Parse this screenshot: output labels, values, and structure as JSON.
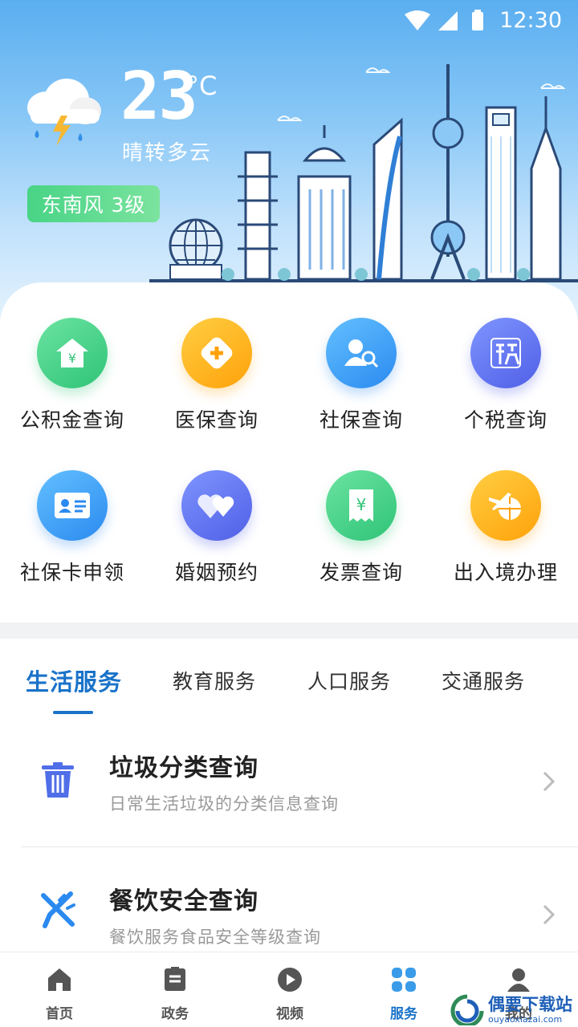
{
  "status_bar": {
    "time": "12:30"
  },
  "weather": {
    "temperature": "23",
    "unit": "°C",
    "description": "晴转多云",
    "wind": "东南风 3级",
    "icon": "thunder-rain-cloud-icon"
  },
  "services": [
    {
      "label": "公积金查询",
      "icon": "house-yuan-icon",
      "color": "#34c478"
    },
    {
      "label": "医保查询",
      "icon": "medical-cross-icon",
      "color": "#ffa20a"
    },
    {
      "label": "社保查询",
      "icon": "person-search-icon",
      "color": "#2b8af0"
    },
    {
      "label": "个税查询",
      "icon": "tax-icon",
      "color": "#4f5fe6"
    },
    {
      "label": "社保卡申领",
      "icon": "id-card-icon",
      "color": "#2b8af0"
    },
    {
      "label": "婚姻预约",
      "icon": "hearts-icon",
      "color": "#4f5fe6"
    },
    {
      "label": "发票查询",
      "icon": "invoice-yuan-icon",
      "color": "#34c478"
    },
    {
      "label": "出入境办理",
      "icon": "plane-globe-icon",
      "color": "#ffa20a"
    }
  ],
  "tabs": [
    {
      "label": "生活服务",
      "active": true
    },
    {
      "label": "教育服务",
      "active": false
    },
    {
      "label": "人口服务",
      "active": false
    },
    {
      "label": "交通服务",
      "active": false
    }
  ],
  "list": [
    {
      "title": "垃圾分类查询",
      "subtitle": "日常生活垃圾的分类信息查询",
      "icon": "trash-icon"
    },
    {
      "title": "餐饮安全查询",
      "subtitle": "餐饮服务食品安全等级查询",
      "icon": "fork-knife-icon"
    }
  ],
  "bottom_nav": [
    {
      "label": "首页",
      "icon": "home-icon",
      "active": false
    },
    {
      "label": "政务",
      "icon": "document-icon",
      "active": false
    },
    {
      "label": "视频",
      "icon": "play-icon",
      "active": false
    },
    {
      "label": "服务",
      "icon": "grid-icon",
      "active": true
    },
    {
      "label": "我的",
      "icon": "user-icon",
      "active": false
    }
  ],
  "watermark": {
    "text": "偶要下载站",
    "url": "ouyaoxiazai.com"
  },
  "colors": {
    "accent": "#1a73c9",
    "wind_badge": "#48d486"
  }
}
